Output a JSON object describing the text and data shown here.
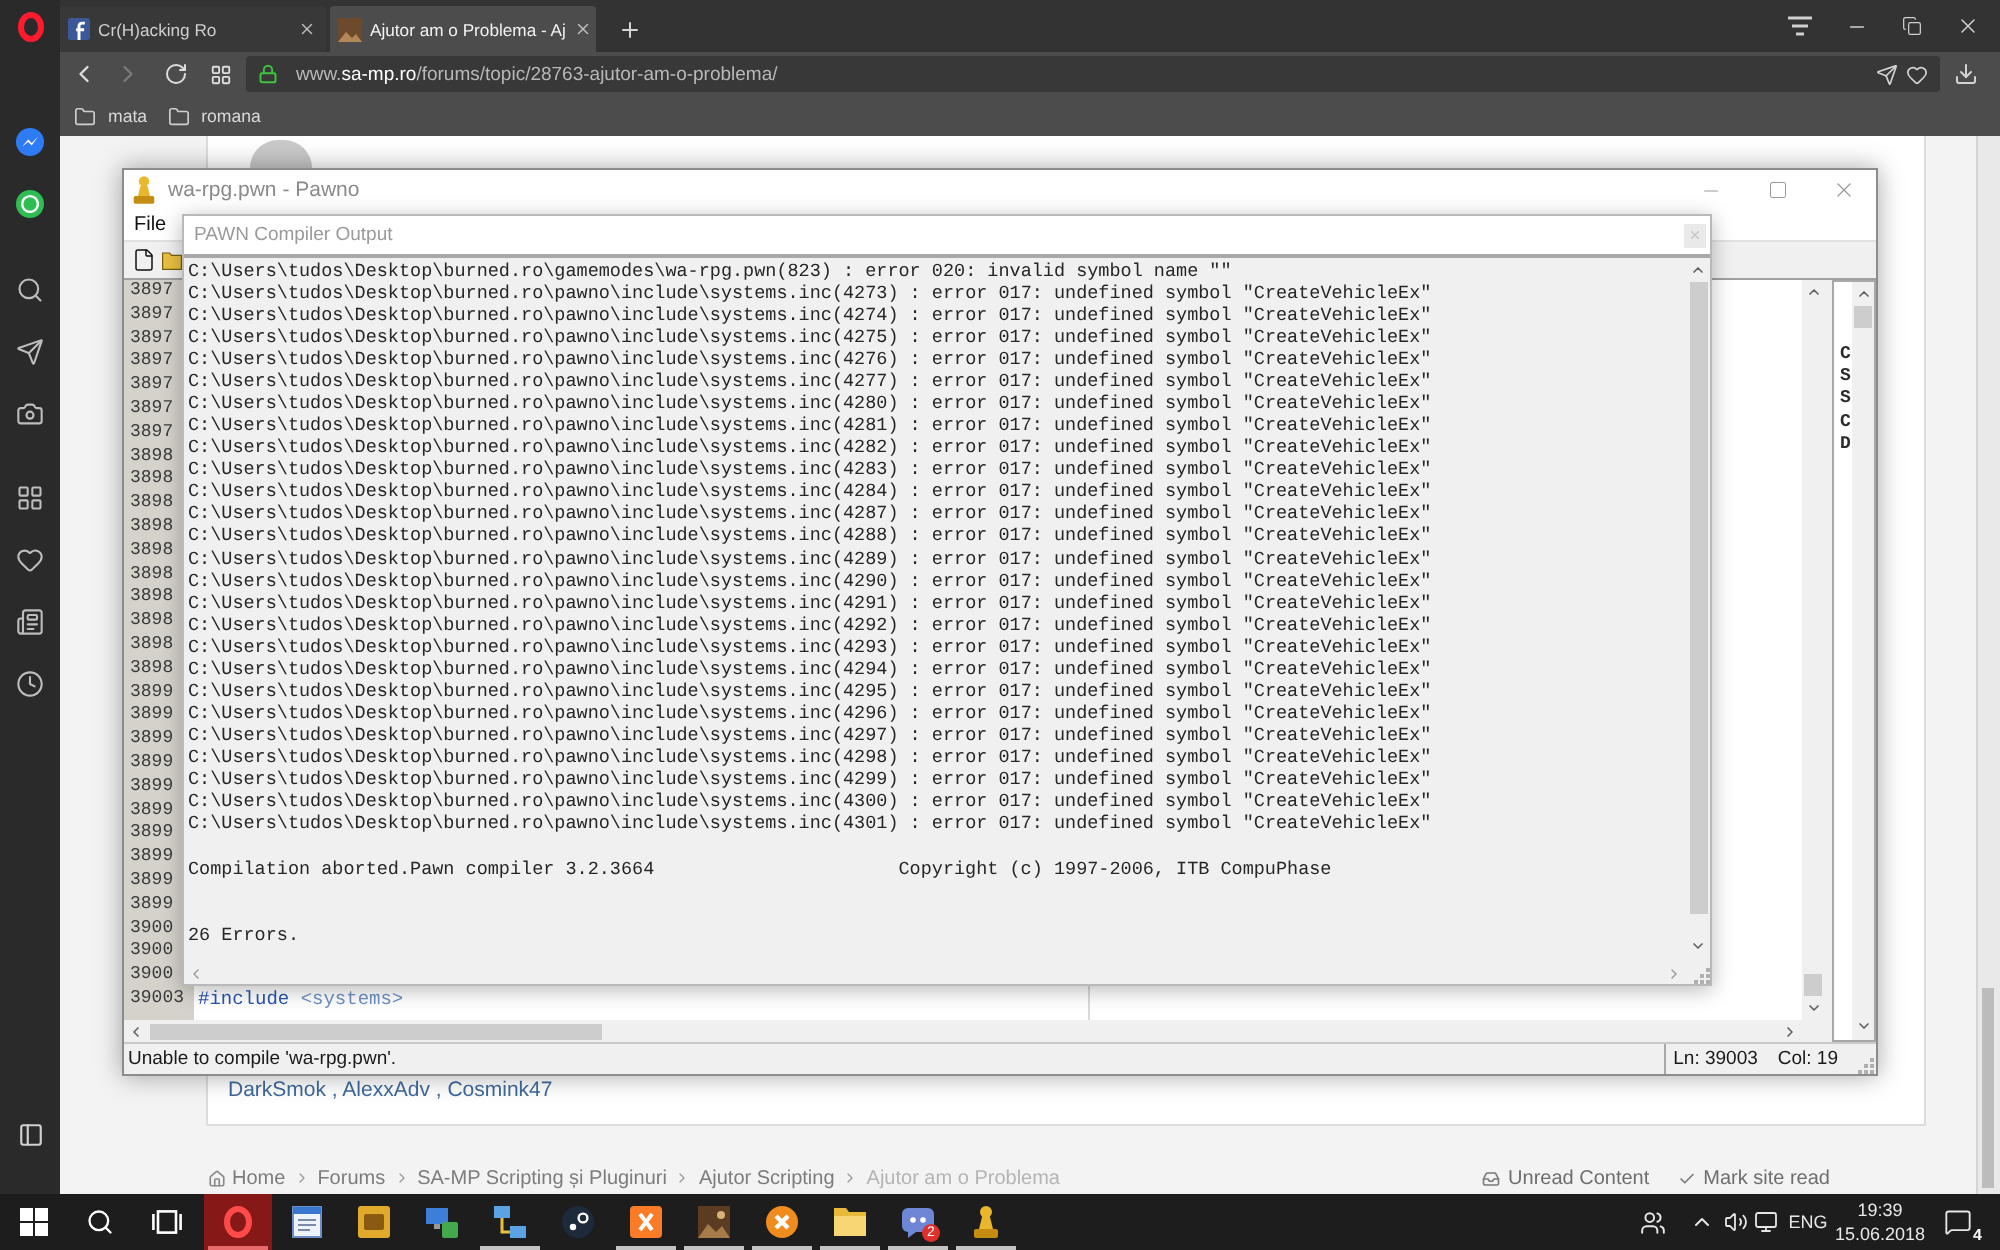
{
  "browser": {
    "tabs": [
      {
        "title": "Cr(H)acking Ro",
        "selected": false
      },
      {
        "title": "Ajutor am o Problema - Aj",
        "selected": true
      }
    ],
    "navigation": {
      "back": {
        "disabled": false
      },
      "forward": {
        "disabled": true
      }
    },
    "address_bar": {
      "url_prefix": "www.",
      "url_host": "sa-mp.ro",
      "url_path": "/forums/topic/28763-ajutor-am-o-problema/"
    },
    "bookmarks": [
      "mata",
      "romana"
    ]
  },
  "pawno": {
    "title": "wa-rpg.pwn - Pawno",
    "menu": [
      "File"
    ],
    "lines": [
      {
        "number": "3897"
      },
      {
        "number": "3897"
      },
      {
        "number": "3897"
      },
      {
        "number": "3897"
      },
      {
        "number": "3897"
      },
      {
        "number": "3897"
      },
      {
        "number": "3897"
      },
      {
        "number": "3898"
      },
      {
        "number": "3898"
      },
      {
        "number": "3898"
      },
      {
        "number": "3898"
      },
      {
        "number": "3898"
      },
      {
        "number": "3898"
      },
      {
        "number": "3898"
      },
      {
        "number": "3898"
      },
      {
        "number": "3898"
      },
      {
        "number": "3898"
      },
      {
        "number": "3899"
      },
      {
        "number": "3899"
      },
      {
        "number": "3899"
      },
      {
        "number": "3899"
      },
      {
        "number": "3899"
      },
      {
        "number": "3899"
      },
      {
        "number": "3899"
      },
      {
        "number": "3899"
      },
      {
        "number": "3899"
      },
      {
        "number": "3899"
      },
      {
        "number": "3900"
      },
      {
        "number": "3900"
      },
      {
        "number": "3900"
      },
      {
        "number": "39003",
        "code": {
          "directive": "#include",
          "argument": "<systems>"
        }
      }
    ],
    "functions": [
      "C",
      "S",
      "S",
      "C",
      "D"
    ],
    "status": {
      "message": "Unable to compile 'wa-rpg.pwn'.",
      "line": "Ln: 39003",
      "column": "Col: 19"
    }
  },
  "compiler_output": {
    "title": "PAWN Compiler Output",
    "errors": [
      "C:\\Users\\tudos\\Desktop\\burned.ro\\gamemodes\\wa-rpg.pwn(823) : error 020: invalid symbol name \"\"",
      "C:\\Users\\tudos\\Desktop\\burned.ro\\pawno\\include\\systems.inc(4273) : error 017: undefined symbol \"CreateVehicleEx\"",
      "C:\\Users\\tudos\\Desktop\\burned.ro\\pawno\\include\\systems.inc(4274) : error 017: undefined symbol \"CreateVehicleEx\"",
      "C:\\Users\\tudos\\Desktop\\burned.ro\\pawno\\include\\systems.inc(4275) : error 017: undefined symbol \"CreateVehicleEx\"",
      "C:\\Users\\tudos\\Desktop\\burned.ro\\pawno\\include\\systems.inc(4276) : error 017: undefined symbol \"CreateVehicleEx\"",
      "C:\\Users\\tudos\\Desktop\\burned.ro\\pawno\\include\\systems.inc(4277) : error 017: undefined symbol \"CreateVehicleEx\"",
      "C:\\Users\\tudos\\Desktop\\burned.ro\\pawno\\include\\systems.inc(4280) : error 017: undefined symbol \"CreateVehicleEx\"",
      "C:\\Users\\tudos\\Desktop\\burned.ro\\pawno\\include\\systems.inc(4281) : error 017: undefined symbol \"CreateVehicleEx\"",
      "C:\\Users\\tudos\\Desktop\\burned.ro\\pawno\\include\\systems.inc(4282) : error 017: undefined symbol \"CreateVehicleEx\"",
      "C:\\Users\\tudos\\Desktop\\burned.ro\\pawno\\include\\systems.inc(4283) : error 017: undefined symbol \"CreateVehicleEx\"",
      "C:\\Users\\tudos\\Desktop\\burned.ro\\pawno\\include\\systems.inc(4284) : error 017: undefined symbol \"CreateVehicleEx\"",
      "C:\\Users\\tudos\\Desktop\\burned.ro\\pawno\\include\\systems.inc(4287) : error 017: undefined symbol \"CreateVehicleEx\"",
      "C:\\Users\\tudos\\Desktop\\burned.ro\\pawno\\include\\systems.inc(4288) : error 017: undefined symbol \"CreateVehicleEx\"",
      "C:\\Users\\tudos\\Desktop\\burned.ro\\pawno\\include\\systems.inc(4289) : error 017: undefined symbol \"CreateVehicleEx\"",
      "C:\\Users\\tudos\\Desktop\\burned.ro\\pawno\\include\\systems.inc(4290) : error 017: undefined symbol \"CreateVehicleEx\"",
      "C:\\Users\\tudos\\Desktop\\burned.ro\\pawno\\include\\systems.inc(4291) : error 017: undefined symbol \"CreateVehicleEx\"",
      "C:\\Users\\tudos\\Desktop\\burned.ro\\pawno\\include\\systems.inc(4292) : error 017: undefined symbol \"CreateVehicleEx\"",
      "C:\\Users\\tudos\\Desktop\\burned.ro\\pawno\\include\\systems.inc(4293) : error 017: undefined symbol \"CreateVehicleEx\"",
      "C:\\Users\\tudos\\Desktop\\burned.ro\\pawno\\include\\systems.inc(4294) : error 017: undefined symbol \"CreateVehicleEx\"",
      "C:\\Users\\tudos\\Desktop\\burned.ro\\pawno\\include\\systems.inc(4295) : error 017: undefined symbol \"CreateVehicleEx\"",
      "C:\\Users\\tudos\\Desktop\\burned.ro\\pawno\\include\\systems.inc(4296) : error 017: undefined symbol \"CreateVehicleEx\"",
      "C:\\Users\\tudos\\Desktop\\burned.ro\\pawno\\include\\systems.inc(4297) : error 017: undefined symbol \"CreateVehicleEx\"",
      "C:\\Users\\tudos\\Desktop\\burned.ro\\pawno\\include\\systems.inc(4298) : error 017: undefined symbol \"CreateVehicleEx\"",
      "C:\\Users\\tudos\\Desktop\\burned.ro\\pawno\\include\\systems.inc(4299) : error 017: undefined symbol \"CreateVehicleEx\"",
      "C:\\Users\\tudos\\Desktop\\burned.ro\\pawno\\include\\systems.inc(4300) : error 017: undefined symbol \"CreateVehicleEx\"",
      "C:\\Users\\tudos\\Desktop\\burned.ro\\pawno\\include\\systems.inc(4301) : error 017: undefined symbol \"CreateVehicleEx\""
    ],
    "summary": "Compilation aborted.Pawn compiler 3.2.3664",
    "copyright": "Copyright (c) 1997-2006, ITB CompuPhase",
    "error_count": "26 Errors."
  },
  "page": {
    "reactions": "DarkSmok , AlexxAdv , Cosmink47",
    "breadcrumb": [
      {
        "label": "Home",
        "current": false
      },
      {
        "label": "Forums",
        "current": false
      },
      {
        "label": "SA-MP Scripting și Pluginuri",
        "current": false
      },
      {
        "label": "Ajutor Scripting",
        "current": false
      },
      {
        "label": "Ajutor am o Problema",
        "current": true
      }
    ],
    "links": [
      {
        "label": "Unread Content",
        "kind": "unread"
      },
      {
        "label": "Mark site read",
        "kind": "mark_read"
      }
    ]
  },
  "taskbar": {
    "apps": [
      {
        "kind": "browser",
        "active": true,
        "running": true
      },
      {
        "kind": "notepad",
        "active": false,
        "running": false
      },
      {
        "kind": "game_tile",
        "active": false,
        "running": false
      },
      {
        "kind": "monitor_lock",
        "active": false,
        "running": false
      },
      {
        "kind": "network",
        "active": false,
        "running": true
      },
      {
        "kind": "disc",
        "active": false,
        "running": false
      },
      {
        "kind": "cross_tile",
        "active": false,
        "running": true
      },
      {
        "kind": "picture",
        "active": false,
        "running": true
      },
      {
        "kind": "cross_circle",
        "active": false,
        "running": true
      },
      {
        "kind": "folder",
        "active": false,
        "running": true
      },
      {
        "kind": "chat",
        "active": false,
        "running": true,
        "badge": "2"
      },
      {
        "kind": "pawn",
        "active": false,
        "running": true
      }
    ],
    "tray": {
      "language": "ENG",
      "time": "19:39",
      "date": "15.06.2018",
      "notifications": "4"
    }
  }
}
